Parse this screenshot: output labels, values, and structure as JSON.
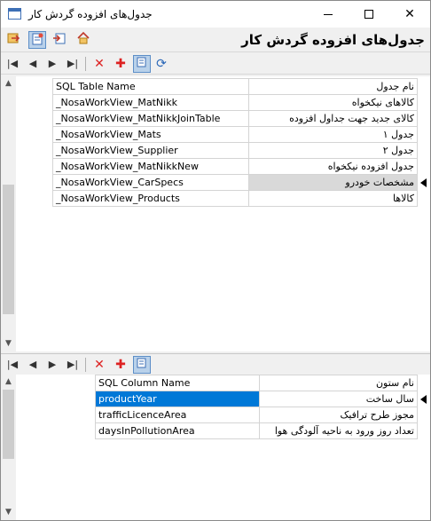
{
  "window": {
    "title": "جدول‌های افزوده گردش کار"
  },
  "header": {
    "title": "جدول‌های افزوده گردش کار"
  },
  "top_grid": {
    "columns": [
      "SQL Table Name",
      "نام جدول"
    ],
    "rows": [
      {
        "sql": "_NosaWorkView_MatNikk",
        "name": "کالاهای نیکخواه"
      },
      {
        "sql": "_NosaWorkView_MatNikkJoinTable",
        "name": "کالای جدید جهت جداول افزوده"
      },
      {
        "sql": "_NosaWorkView_Mats",
        "name": "جدول ۱"
      },
      {
        "sql": "_NosaWorkView_Supplier",
        "name": "جدول ۲"
      },
      {
        "sql": "_NosaWorkView_MatNikkNew",
        "name": "جدول افزوده نیکخواه"
      },
      {
        "sql": "_NosaWorkView_CarSpecs",
        "name": "مشخصات خودرو"
      },
      {
        "sql": "_NosaWorkView_Products",
        "name": "کالاها"
      }
    ]
  },
  "bottom_grid": {
    "columns": [
      "SQL Column Name",
      "نام ستون"
    ],
    "rows": [
      {
        "sql": "productYear",
        "name": "سال ساخت"
      },
      {
        "sql": "trafficLicenceArea",
        "name": "مجوز طرح ترافیک"
      },
      {
        "sql": "daysInPollutionArea",
        "name": "تعداد روز ورود به ناحیه آلودگی هوا"
      }
    ]
  }
}
